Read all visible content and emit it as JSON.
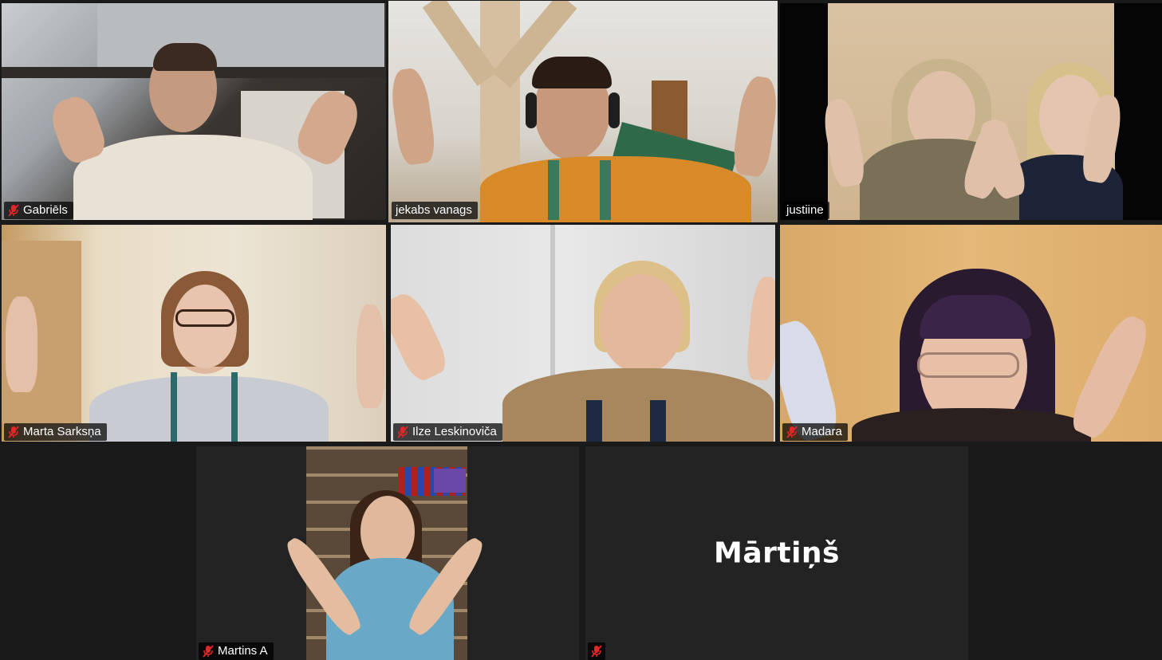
{
  "participants": [
    {
      "name": "Gabriēls",
      "muted": true,
      "speaking": false
    },
    {
      "name": "jekabs vanags",
      "muted": false,
      "speaking": true
    },
    {
      "name": "justiine",
      "muted": false,
      "speaking": false
    },
    {
      "name": "Marta Sarksņa",
      "muted": true,
      "speaking": false
    },
    {
      "name": "Ilze Leskinoviča",
      "muted": true,
      "speaking": false
    },
    {
      "name": "Madara",
      "muted": true,
      "speaking": false
    },
    {
      "name": "Martins A",
      "muted": true,
      "speaking": false
    },
    {
      "name": "Mārtiņš",
      "muted": true,
      "speaking": false,
      "video_off": true
    }
  ],
  "colors": {
    "background": "#1a1a1a",
    "active_speaker_border": "#d4e157",
    "mute_icon": "#e02828"
  },
  "icons": {
    "muted": "microphone-muted-icon"
  }
}
